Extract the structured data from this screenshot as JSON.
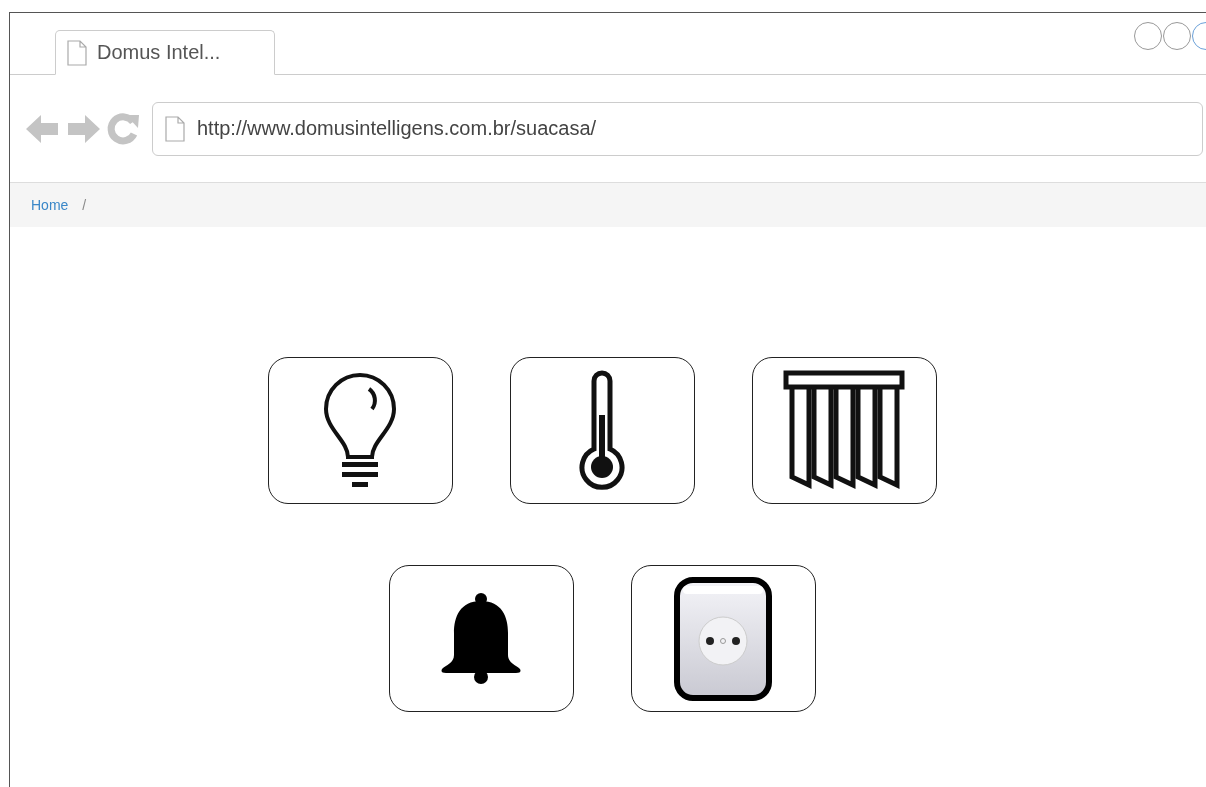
{
  "browser": {
    "tab_title": "Domus Intel...",
    "url": "http://www.domusintelligens.com.br/suacasa/"
  },
  "breadcrumb": [
    {
      "label": "Home",
      "kind": "link"
    },
    {
      "label": "/",
      "kind": "separator"
    }
  ],
  "device_rows": [
    {
      "tiles": [
        {
          "kind": "bulb"
        },
        {
          "kind": "thermometer"
        },
        {
          "kind": "blinds"
        }
      ]
    },
    {
      "tiles": [
        {
          "kind": "bell"
        },
        {
          "kind": "socket"
        }
      ]
    }
  ]
}
